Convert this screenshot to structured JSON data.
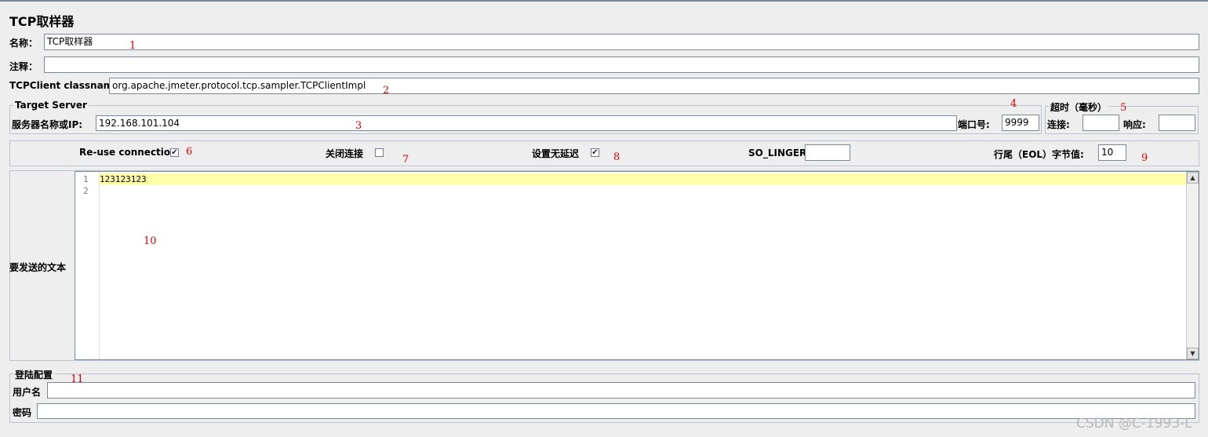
{
  "title": "TCP取样器",
  "name": {
    "label": "名称：",
    "value": "TCP取样器"
  },
  "comment": {
    "label": "注释：",
    "value": ""
  },
  "classname": {
    "label": "TCPClient classname:",
    "value": "org.apache.jmeter.protocol.tcp.sampler.TCPClientImpl"
  },
  "target_server": {
    "legend": "Target Server",
    "host_label": "服务器名称或IP:",
    "host_value": "192.168.101.104",
    "port_label": "端口号:",
    "port_value": "9999"
  },
  "timeout": {
    "legend": "超时（毫秒）",
    "connect_label": "连接:",
    "connect_value": "",
    "response_label": "响应:",
    "response_value": ""
  },
  "options": {
    "reuse_label": "Re-use connection",
    "reuse_checked": true,
    "close_label": "关闭连接",
    "close_checked": false,
    "nodelay_label": "设置无延迟",
    "nodelay_checked": true,
    "solinger_label": "SO_LINGER:",
    "solinger_value": "",
    "eol_label": "行尾（EOL）字节值:",
    "eol_value": "10"
  },
  "text_to_send": {
    "label": "要发送的文本",
    "line_numbers": [
      "1",
      "2"
    ],
    "content": "123123123"
  },
  "login": {
    "legend": "登陆配置",
    "username_label": "用户名",
    "username_value": "",
    "password_label": "密码",
    "password_value": ""
  },
  "annotations": [
    "1",
    "2",
    "3",
    "4",
    "5",
    "6",
    "7",
    "8",
    "9",
    "10",
    "11"
  ],
  "watermark": "CSDN @C-1993-L",
  "check_mark": "✔",
  "colors": {
    "annotation": "#e00000",
    "highlight_line": "#ffffaa",
    "border": "#7a8a99"
  }
}
